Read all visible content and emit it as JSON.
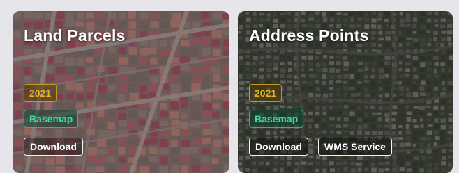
{
  "cards": [
    {
      "title": "Land Parcels",
      "year": "2021",
      "type": "Basemap",
      "buttons": [
        "Download"
      ],
      "image": "parcel-map"
    },
    {
      "title": "Address Points",
      "year": "2021",
      "type": "Basemap",
      "buttons": [
        "Download",
        "WMS Service"
      ],
      "image": "aerial-imagery"
    }
  ],
  "colors": {
    "year_badge": "#e3b327",
    "type_badge": "#3dd6a3",
    "button_border": "#f2f2f2"
  }
}
